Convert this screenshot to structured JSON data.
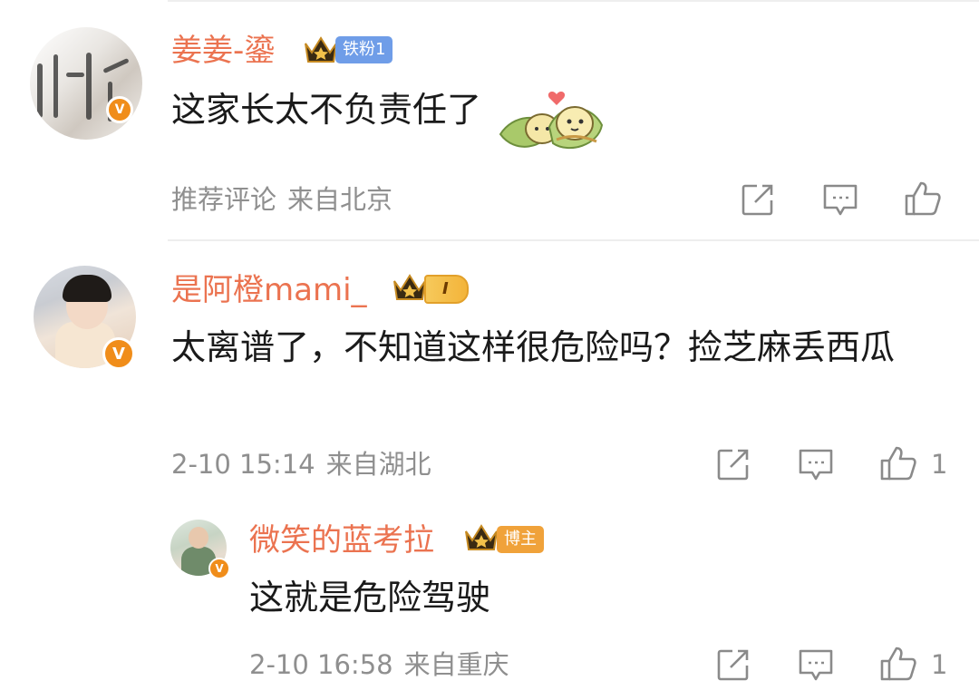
{
  "comments": [
    {
      "user": "姜姜-鎏",
      "badge": "铁粉1",
      "text": "这家长太不负责任了",
      "meta_time": "推荐评论",
      "meta_source": "来自北京",
      "like_count": ""
    },
    {
      "user": "是阿橙mami_",
      "badge": "I",
      "text": "太离谱了，不知道这样很危险吗？捡芝麻丢西瓜",
      "meta_time": "2-10 15:14",
      "meta_source": "来自湖北",
      "like_count": "1"
    },
    {
      "user": "微笑的蓝考拉",
      "badge": "博主",
      "text": "这就是危险驾驶",
      "meta_time": "2-10 16:58",
      "meta_source": "来自重庆",
      "like_count": "1"
    }
  ],
  "verified_mark": "V",
  "colors": {
    "username": "#eb7350",
    "meta": "#8f8f8f",
    "badge_blue": "#6f9de8",
    "badge_orange": "#f0a23a",
    "verified": "#f08d1a"
  }
}
